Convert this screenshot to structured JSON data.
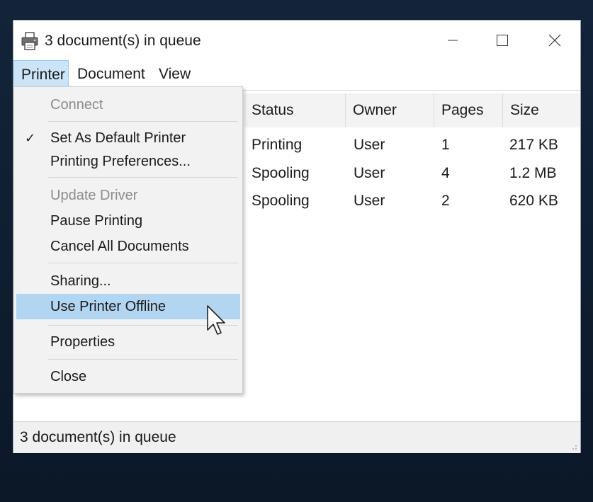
{
  "window": {
    "title": "3 document(s) in queue",
    "controls": {
      "minimize": "minimize-icon",
      "maximize": "maximize-icon",
      "close": "close-icon"
    }
  },
  "menubar": {
    "items": [
      {
        "label": "Printer"
      },
      {
        "label": "Document"
      },
      {
        "label": "View"
      }
    ]
  },
  "printer_menu": {
    "items": [
      {
        "label": "Connect",
        "disabled": true
      },
      {
        "label": "Set As Default Printer",
        "checked": true
      },
      {
        "label": "Printing Preferences..."
      },
      {
        "label": "Update Driver",
        "disabled": true
      },
      {
        "label": "Pause Printing"
      },
      {
        "label": "Cancel All Documents"
      },
      {
        "label": "Sharing..."
      },
      {
        "label": "Use Printer Offline",
        "highlighted": true
      },
      {
        "label": "Properties"
      },
      {
        "label": "Close"
      }
    ],
    "check_glyph": "✓"
  },
  "table": {
    "columns": [
      "Status",
      "Owner",
      "Pages",
      "Size"
    ],
    "rows": [
      {
        "status": "Printing",
        "owner": "User",
        "pages": "1",
        "size": "217 KB"
      },
      {
        "status": "Spooling",
        "owner": "User",
        "pages": "4",
        "size": "1.2 MB"
      },
      {
        "status": "Spooling",
        "owner": "User",
        "pages": "2",
        "size": "620 KB"
      }
    ]
  },
  "statusbar": {
    "text": "3 document(s) in queue"
  },
  "colors": {
    "menu_highlight": "#b2d6f2",
    "menu_active": "#cce4f7",
    "disabled_text": "#8c8c8c"
  }
}
